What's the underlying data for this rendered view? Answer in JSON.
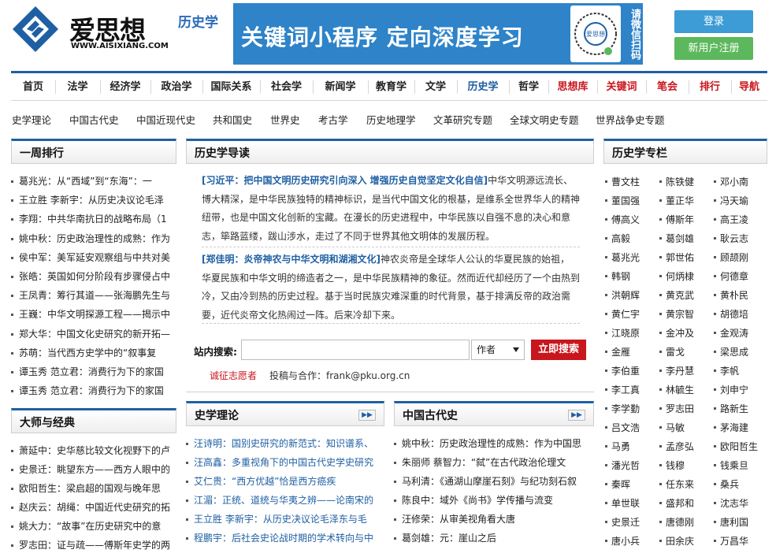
{
  "header": {
    "brand": "爱思想",
    "url": "WWW.AISIXIANG.COM",
    "section_tag": "历史学",
    "banner_text": "关键词小程序 定向深度学习",
    "banner_qr_label": "爱思想",
    "banner_side": "请微信扫码",
    "login_label": "登录",
    "register_label": "新用户注册",
    "colors": {
      "brand_blue": "#1f5fa3",
      "banner_blue": "#2e83c9",
      "red": "#c8161d",
      "green": "#5cb85c"
    }
  },
  "mainnav": [
    "首页",
    "法学",
    "经济学",
    "政治学",
    "国际关系",
    "社会学",
    "新闻学",
    "教育学",
    "文学",
    "历史学",
    "哲学",
    "思想库",
    "关键词",
    "笔会",
    "排行",
    "导航"
  ],
  "subnav": [
    "史学理论",
    "中国古代史",
    "中国近现代史",
    "共和国史",
    "世界史",
    "考古学",
    "历史地理学",
    "文革研究专题",
    "全球文明史专题",
    "世界战争史专题"
  ],
  "weekly": {
    "title": "一周排行",
    "items": [
      "葛兆光：从“西域”到“东海”：一",
      "王立胜 李新宇：从历史决议论毛泽",
      "李翔：中共华南抗日的战略布局（1",
      "姚中秋：历史政治理性的成熟：作为",
      "侯中军：美军延安观察组与中共对美",
      "张皓：英国如何分阶段有步骤侵占中",
      "王凤青：筹行其道——张海鹏先生与",
      "王巍：中华文明探源工程——揭示中",
      "郑大华：中国文化史研究的新开拓—",
      "苏萌：当代西方史学中的“叙事复",
      "谭玉秀 范立君：消费行为下的家国",
      "谭玉秀 范立君：消费行为下的家国"
    ]
  },
  "masters": {
    "title": "大师与经典",
    "items": [
      "萧延中：史华慈比较文化视野下的卢",
      "史景迁：眺望东方——西方人眼中的",
      "欧阳哲生：梁启超的国观与晚年思",
      "赵庆云：胡绳：中国近代史研究的拓",
      "姚大力：“故事”在历史研究中的意",
      "罗志田：证与疏——傅斯年史学的两"
    ]
  },
  "guide": {
    "title": "历史学导读",
    "p1_title": "[习近平：把中国文明历史研究引向深入 增强历史自觉坚定文化自信]",
    "p1_lines": [
      "中华文明源远流长、",
      "博大精深，是中华民族独特的精神标识，是当代中国文化的根基，是维系全世界华人的精神",
      "纽带，也是中国文化创新的宝藏。在漫长的历史进程中，中华民族以自强不息的决心和意",
      "志，筚路蓝缕，跋山涉水，走过了不同于世界其他文明体的发展历程。"
    ],
    "p2_title": "[郑佳明：炎帝神农与中华文明和湖湘文化]",
    "p2_lines": [
      "神农炎帝是全球华人公认的华夏民族的始祖，",
      "华夏民族和中华文明的缔造者之一，是中华民族精神的象征。然而近代却经历了一个由热到",
      "冷，又由冷到热的历史过程。基于当时民族灾难深重的时代背景，基于排满反帝的政治需",
      "要，近代炎帝文化热闹过一阵。后来冷却下来。"
    ]
  },
  "search": {
    "label": "站内搜索:",
    "placeholder": "",
    "select_value": "作者",
    "button": "立即搜索",
    "volunteer": "诚征志愿者",
    "contact": "投稿与合作：frank@pku.org.cn"
  },
  "theory": {
    "title": "史学理论",
    "items": [
      "汪诗明：国别史研究的新范式：知识谱系、",
      "汪高鑫：多重视角下的中国古代史学史研究",
      "艾仁贵：“西方优越”恰是西方癌疾",
      "江湄：正统、道统与华夷之辨——论南宋的",
      "王立胜 李新宇：从历史决议论毛泽东与毛",
      "程鹏宇：后社会史论战时期的学术转向与中"
    ]
  },
  "ancient": {
    "title": "中国古代史",
    "items": [
      "姚中秋：历史政治理性的成熟：作为中国思",
      "朱丽师 蔡智力：“弑”在古代政治伦理文",
      "马利清：《通湖山摩崖石刻》与纪功刻石叙",
      "陈良中：域外《尚书》学传播与流变",
      "汪修荣：从审美视角看大唐",
      "葛剑雄：元：崖山之后"
    ]
  },
  "columnists": {
    "title": "历史学专栏",
    "names": [
      [
        "曹文柱",
        "陈铁健",
        "邓小南"
      ],
      [
        "董国强",
        "董正华",
        "冯天瑜"
      ],
      [
        "傅高义",
        "傅斯年",
        "高王凌"
      ],
      [
        "高毅",
        "葛剑雄",
        "耿云志"
      ],
      [
        "葛兆光",
        "郭世佑",
        "顾颉刚"
      ],
      [
        "韩钢",
        "何炳棣",
        "何德章"
      ],
      [
        "洪朝辉",
        "黄克武",
        "黄朴民"
      ],
      [
        "黄仁宇",
        "黄宗智",
        "胡德培"
      ],
      [
        "江晓原",
        "金冲及",
        "金观涛"
      ],
      [
        "金雁",
        "雷戈",
        "梁思成"
      ],
      [
        "李伯重",
        "李丹慧",
        "李帆"
      ],
      [
        "李工真",
        "林毓生",
        "刘申宁"
      ],
      [
        "李学勤",
        "罗志田",
        "路新生"
      ],
      [
        "吕文浩",
        "马敏",
        "茅海建"
      ],
      [
        "马勇",
        "孟彦弘",
        "欧阳哲生"
      ],
      [
        "潘光哲",
        "钱穆",
        "钱乘旦"
      ],
      [
        "秦晖",
        "任东来",
        "桑兵"
      ],
      [
        "单世联",
        "盛邦和",
        "沈志华"
      ],
      [
        "史景迁",
        "唐德刚",
        "唐利国"
      ],
      [
        "唐小兵",
        "田余庆",
        "万昌华"
      ]
    ]
  }
}
